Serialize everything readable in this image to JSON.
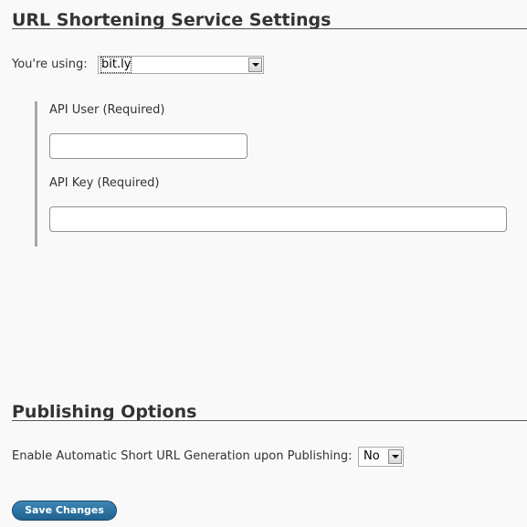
{
  "url_section": {
    "title": "URL Shortening Service Settings",
    "using_label": "You're using:",
    "service_selected": "bit.ly",
    "api_user_label": "API User (Required)",
    "api_user_value": "",
    "api_key_label": "API Key (Required)",
    "api_key_value": ""
  },
  "publishing_section": {
    "title": "Publishing Options",
    "auto_label": "Enable Automatic Short URL Generation upon Publishing:",
    "auto_selected": "No"
  },
  "actions": {
    "save_label": "Save Changes"
  },
  "colors": {
    "background": "#f9f9f9",
    "button": "#21628f",
    "divider": "#555555"
  },
  "icons": {
    "dropdown": "chevron-down-icon"
  }
}
